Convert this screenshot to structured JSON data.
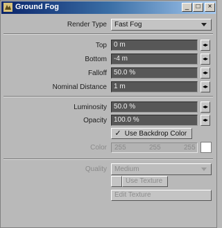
{
  "window": {
    "title": "Ground Fog",
    "controls": {
      "minimize": "_",
      "maximize": "□",
      "close": "×"
    }
  },
  "render_type": {
    "label": "Render Type",
    "value": "Fast Fog"
  },
  "geometry": {
    "top": {
      "label": "Top",
      "value": "0 m"
    },
    "bottom": {
      "label": "Bottom",
      "value": "-4 m"
    },
    "falloff": {
      "label": "Falloff",
      "value": "50.0 %"
    },
    "nominal_distance": {
      "label": "Nominal Distance",
      "value": "1 m"
    }
  },
  "appearance": {
    "luminosity": {
      "label": "Luminosity",
      "value": "50.0 %"
    },
    "opacity": {
      "label": "Opacity",
      "value": "100.0 %"
    },
    "use_backdrop": {
      "label": "Use Backdrop Color",
      "checked": true,
      "mark": "✓"
    },
    "color": {
      "label": "Color",
      "r": "255",
      "g": "255",
      "b": "255",
      "swatch": "#ffffff"
    }
  },
  "quality": {
    "label": "Quality",
    "value": "Medium",
    "use_texture_label": "Use Texture",
    "edit_texture_label": "Edit Texture"
  },
  "stepper_glyph": "◂▸"
}
